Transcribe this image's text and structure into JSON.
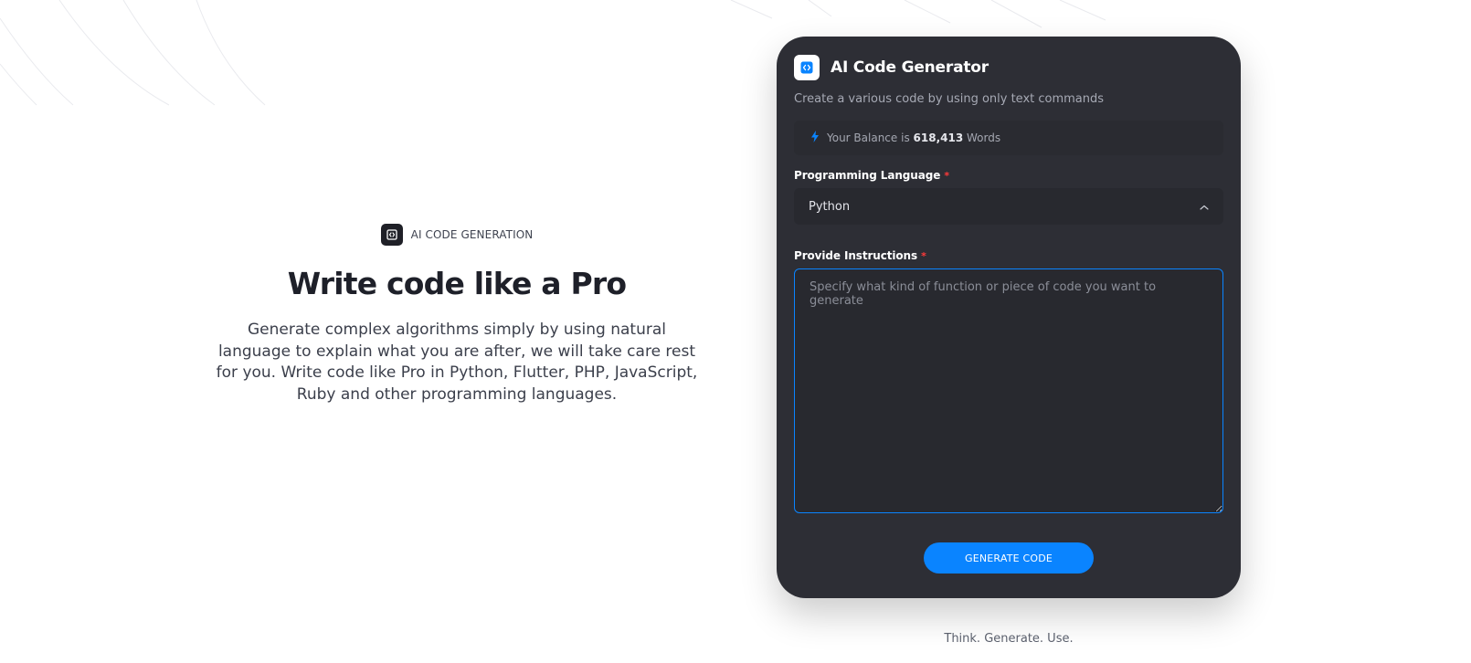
{
  "hero": {
    "eyebrow_label": "AI CODE GENERATION",
    "eyebrow_icon": "code-icon",
    "title": "Write code like a Pro",
    "description": "Generate complex algorithms simply by using natural language to explain what you are after, we will take care rest for you. Write code like Pro in Python, Flutter, PHP, JavaScript, Ruby and other programming languages."
  },
  "card": {
    "logo_icon": "code-icon",
    "title": "AI Code Generator",
    "subtitle": "Create a various code by using only text commands",
    "balance": {
      "icon": "bolt-icon",
      "prefix": "Your Balance is",
      "amount": "618,413",
      "suffix": "Words"
    },
    "language_field": {
      "label": "Programming Language",
      "required_mark": "*",
      "selected": "Python",
      "chevron_icon": "chevron-up-icon"
    },
    "instructions_field": {
      "label": "Provide Instructions",
      "required_mark": "*",
      "value": "",
      "placeholder": "Specify what kind of function or piece of code you want to generate"
    },
    "generate_button": "GENERATE CODE"
  },
  "tagline": "Think. Generate. Use.",
  "colors": {
    "accent": "#0a84ff",
    "card_background": "#2d2e35",
    "required": "#ff3a3a"
  }
}
